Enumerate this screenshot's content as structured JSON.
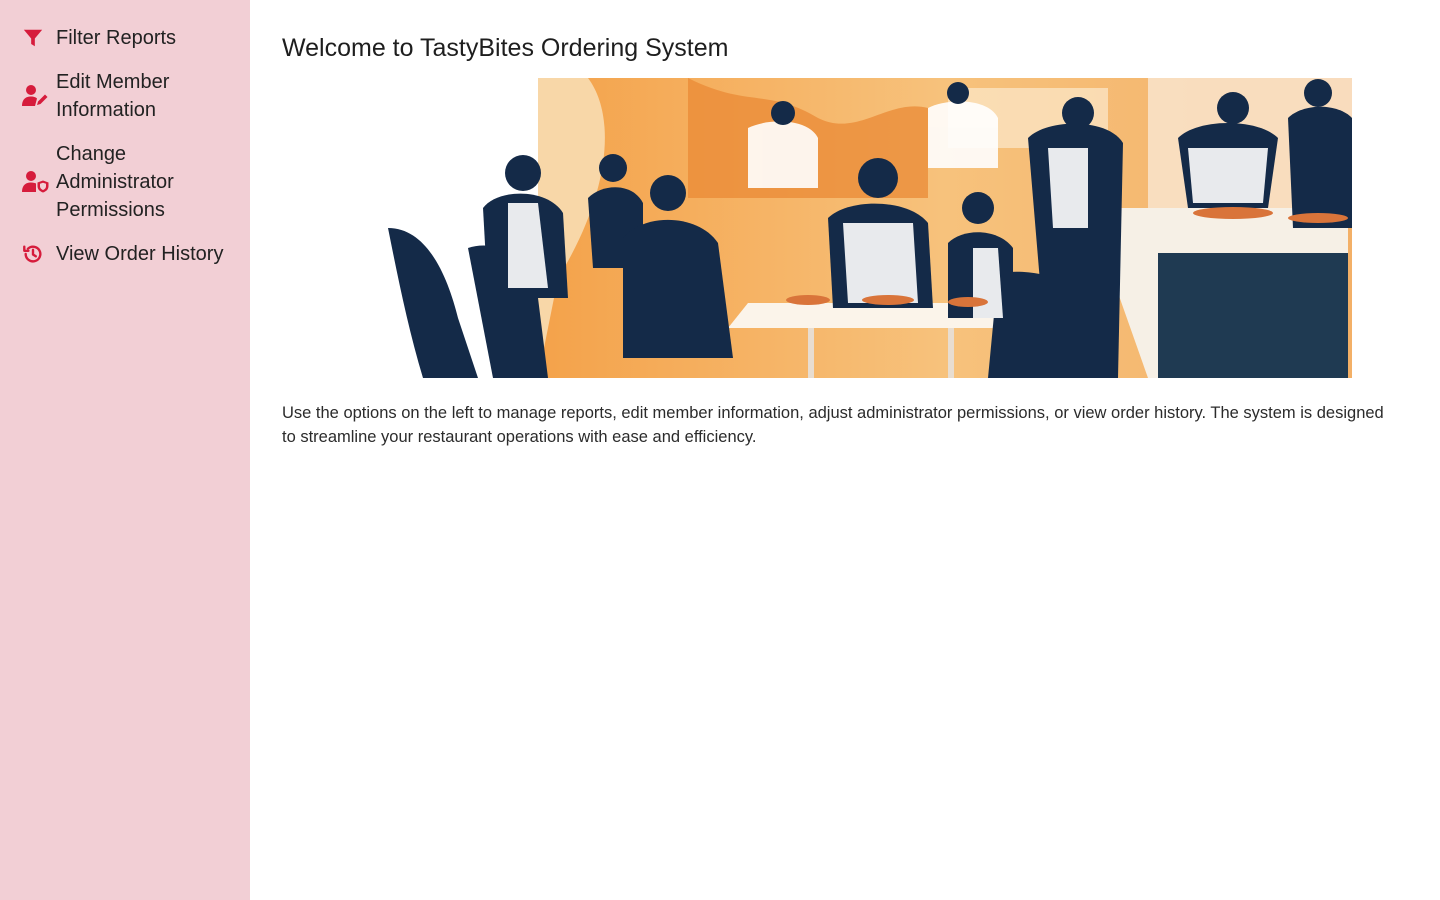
{
  "sidebar": {
    "items": [
      {
        "label": "Filter Reports",
        "icon": "filter-icon"
      },
      {
        "label": "Edit Member Information",
        "icon": "user-edit-icon"
      },
      {
        "label": "Change Administrator Permissions",
        "icon": "user-shield-icon"
      },
      {
        "label": "View Order History",
        "icon": "history-icon"
      }
    ]
  },
  "main": {
    "title": "Welcome to TastyBites Ordering System",
    "description": "Use the options on the left to manage reports, edit member information, adjust administrator permissions, or view order history. The system is designed to streamline your restaurant operations with ease and efficiency."
  },
  "colors": {
    "sidebar_bg": "#f2cfd5",
    "icon_accent": "#d61c3c"
  }
}
